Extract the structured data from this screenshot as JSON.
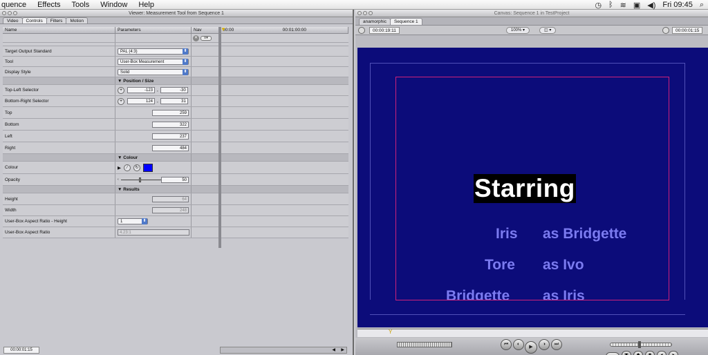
{
  "menubar": {
    "items": [
      "quence",
      "Effects",
      "Tools",
      "Window",
      "Help"
    ],
    "clock": "Fri 09:45"
  },
  "viewer": {
    "title": "Viewer: Measurement Tool from Sequence 1",
    "tabs": [
      "Video",
      "Controls",
      "Filters",
      "Motion"
    ],
    "columns": {
      "name": "Name",
      "parameters": "Parameters",
      "nav": "Nav"
    },
    "timecodes": {
      "start": "00:00",
      "mid": "00:01:00:00"
    },
    "rows": {
      "target_output": {
        "label": "Target Output Standard",
        "value": "PAL (4:3)"
      },
      "tool": {
        "label": "Tool",
        "value": "User-Box Measurement"
      },
      "display_style": {
        "label": "Display Style",
        "value": "Solid"
      },
      "position_size": "Position / Size",
      "top_left": {
        "label": "Top-Left Selector",
        "x": "-123",
        "y": "-30"
      },
      "bottom_right": {
        "label": "Bottom-Right Selector",
        "x": "124",
        "y": "31"
      },
      "top": {
        "label": "Top",
        "value": "259"
      },
      "bottom": {
        "label": "Bottom",
        "value": "322"
      },
      "left": {
        "label": "Left",
        "value": "237"
      },
      "right": {
        "label": "Right",
        "value": "484"
      },
      "colour_section": "Colour",
      "colour": {
        "label": "Colour",
        "swatch": "#0000ff"
      },
      "opacity": {
        "label": "Opacity",
        "value": "50"
      },
      "results": "Results",
      "height": {
        "label": "Height",
        "value": "64"
      },
      "width": {
        "label": "Width",
        "value": "248"
      },
      "aspect_height": {
        "label": "User-Box Aspect Ratio - Height",
        "value": "1"
      },
      "aspect_ratio": {
        "label": "User-Box Aspect Ratio",
        "value": "4.23:1"
      }
    },
    "bottom_timecode": "00:00:01:15"
  },
  "canvas": {
    "title": "Canvas: Sequence 1 in TestProject",
    "tabs": [
      "anamorphic",
      "Sequence 1"
    ],
    "timecode_left": "00:00:19:11",
    "zoom": "100%",
    "timecode_right": "00:00:01:15",
    "frame_color": "#0c0c7a",
    "starring": "Starring",
    "credits": [
      {
        "actor": "Iris",
        "role": "as Bridgette"
      },
      {
        "actor": "Tore",
        "role": "as Ivo"
      },
      {
        "actor": "Bridgette",
        "role": "as Iris"
      }
    ]
  }
}
